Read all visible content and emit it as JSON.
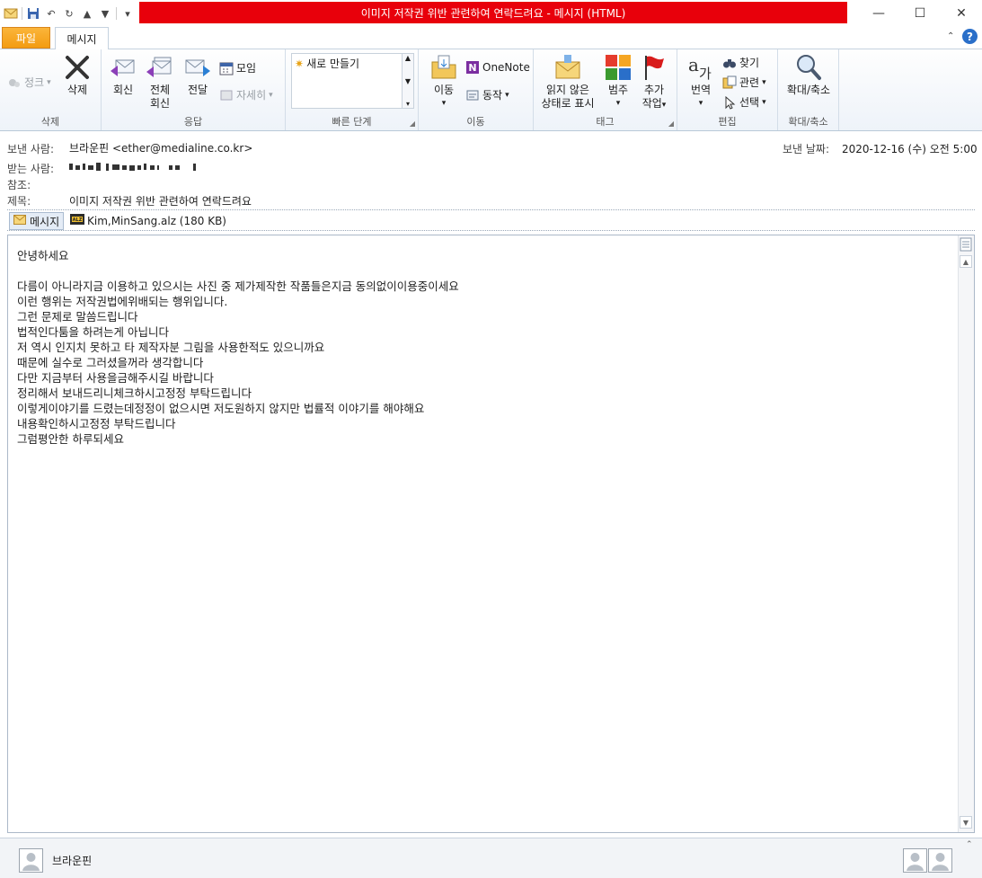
{
  "window": {
    "title": "이미지 저작권 위반 관련하여 연락드려요  -  메시지 (HTML)",
    "minimize_glyph": "—",
    "maximize_glyph": "☐",
    "close_glyph": "✕"
  },
  "tabs": {
    "file": "파일",
    "message": "메시지"
  },
  "ribbon": {
    "groups": {
      "delete": {
        "label": "삭제",
        "junk": "정크",
        "delete_btn": "삭제"
      },
      "respond": {
        "label": "응답",
        "reply": "회신",
        "reply_all_line1": "전체",
        "reply_all_line2": "회신",
        "forward": "전달",
        "meeting": "모임",
        "more": "자세히"
      },
      "quick_steps": {
        "label": "빠른 단계",
        "create_new": "새로 만들기"
      },
      "move": {
        "label": "이동",
        "move_btn": "이동",
        "onenote": "OneNote",
        "actions": "동작"
      },
      "tags": {
        "label": "태그",
        "mark_unread_line1": "읽지 않은",
        "mark_unread_line2": "상태로 표시",
        "categorize": "범주",
        "followup_line1": "추가",
        "followup_line2": "작업"
      },
      "editing": {
        "label": "편집",
        "translate": "번역",
        "find": "찾기",
        "related": "관련",
        "select": "선택"
      },
      "zoom": {
        "label": "확대/축소",
        "zoom_btn": "확대/축소"
      }
    }
  },
  "header": {
    "from_label": "보낸 사람:",
    "from_value": "브라운핀 <ether@medialine.co.kr>",
    "to_label": "받는 사람:",
    "cc_label": "참조:",
    "subject_label": "제목:",
    "subject_value": "이미지 저작권 위반 관련하여 연락드려요",
    "sent_label": "보낸 날짜:",
    "sent_value": "2020-12-16 (수) 오전 5:00"
  },
  "attachments": {
    "message_tab": "메시지",
    "file": "Kim,MinSang.alz (180 KB)"
  },
  "body": {
    "greeting": "안녕하세요",
    "lines": [
      "다름이 아니라지금 이용하고 있으시는 사진 중 제가제작한 작품들은지금 동의없이이용중이세요",
      "이런 행위는 저작권법에위배되는 행위입니다.",
      "그런 문제로 말씀드립니다",
      "법적인다툼을 하려는게 아닙니다",
      "저 역시 인지치 못하고 타 제작자분  그림을 사용한적도 있으니까요",
      "때문에 실수로 그러셨을꺼라 생각합니다",
      "다만 지금부터 사용을금해주시길 바랍니다",
      "정리해서 보내드리니체크하시고정정 부탁드립니다",
      "이렇게이야기를 드렸는데정정이 없으시면 저도원하지 않지만 법률적 이야기를 해야해요",
      "내용확인하시고정정 부탁드립니다",
      "그럼평안한 하루되세요"
    ]
  },
  "footer": {
    "contact_name": "브라운핀"
  },
  "colors": {
    "title_bg": "#e8000b",
    "file_tab": "#f39c12",
    "help": "#2a6fc9"
  }
}
